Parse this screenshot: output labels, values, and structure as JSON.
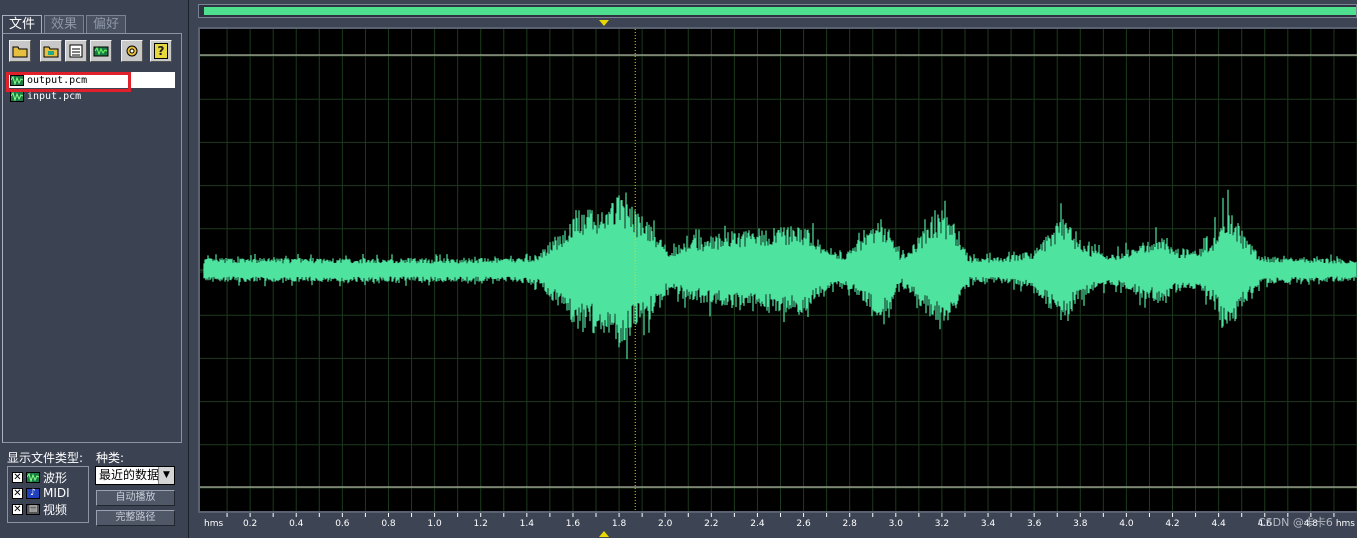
{
  "tabs": [
    {
      "label": "文件",
      "active": true
    },
    {
      "label": "效果",
      "active": false
    },
    {
      "label": "偏好",
      "active": false
    }
  ],
  "toolbar": {
    "help_label": "?"
  },
  "files": [
    {
      "name": "output.pcm",
      "selected": true
    },
    {
      "name": "input.pcm",
      "selected": false
    }
  ],
  "filter": {
    "types_label": "显示文件类型:",
    "kind_label": "种类:",
    "types": [
      {
        "label": "波形",
        "checked": true,
        "icon": "waveform-icon"
      },
      {
        "label": "MIDI",
        "checked": true,
        "icon": "midi-note-icon"
      },
      {
        "label": "视频",
        "checked": true,
        "icon": "video-icon"
      }
    ],
    "kind_value": "最近的数据",
    "autoplay_label": "自动播放",
    "fullpath_label": "完整路径"
  },
  "waveform": {
    "color": "#4fe3a0",
    "playhead_time": 1.87,
    "time_range": [
      0,
      5.0
    ]
  },
  "ruler": {
    "unit": "hms",
    "ticks": [
      "0.2",
      "0.4",
      "0.6",
      "0.8",
      "1.0",
      "1.2",
      "1.4",
      "1.6",
      "1.8",
      "2.0",
      "2.2",
      "2.4",
      "2.6",
      "2.8",
      "3.0",
      "3.2",
      "3.4",
      "3.6",
      "3.8",
      "4.0",
      "4.2",
      "4.4",
      "4.6",
      "4.8"
    ],
    "end_unit": "hms"
  },
  "watermark": "CSDN @卡卡6"
}
